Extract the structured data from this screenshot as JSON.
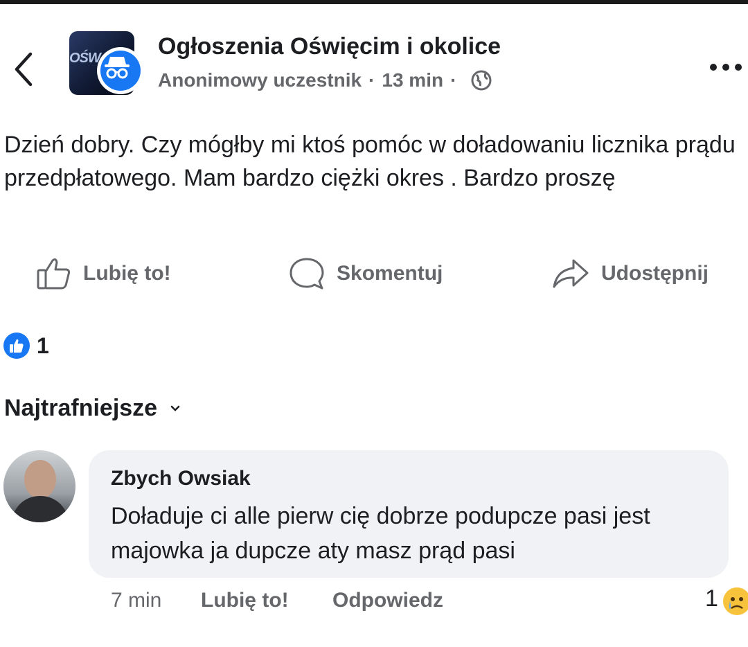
{
  "header": {
    "group_name": "Ogłoszenia Oświęcim i okolice",
    "author": "Anonimowy uczestnik",
    "separator": "·",
    "time": "13 min",
    "avatar_text": "OŚW"
  },
  "post": {
    "text": "Dzień dobry.  Czy mógłby mi ktoś pomóc w doładowaniu licznika prądu przedpłatowego. Mam bardzo ciężki okres . Bardzo proszę"
  },
  "actions": {
    "like": "Lubię to!",
    "comment": "Skomentuj",
    "share": "Udostępnij"
  },
  "reactions": {
    "count": "1"
  },
  "comments_sort": {
    "label": "Najtrafniejsze"
  },
  "comment": {
    "author": "Zbych Owsiak",
    "text": "Doładuje ci alle pierw cię dobrze podupcze pasi jest majowka ja dupcze aty masz prąd pasi",
    "time": "7 min",
    "like": "Lubię to!",
    "reply": "Odpowiedz",
    "reaction_count": "1"
  },
  "colors": {
    "accent": "#1877f2",
    "secondary_text": "#65676b",
    "bubble": "#f0f2f5"
  }
}
